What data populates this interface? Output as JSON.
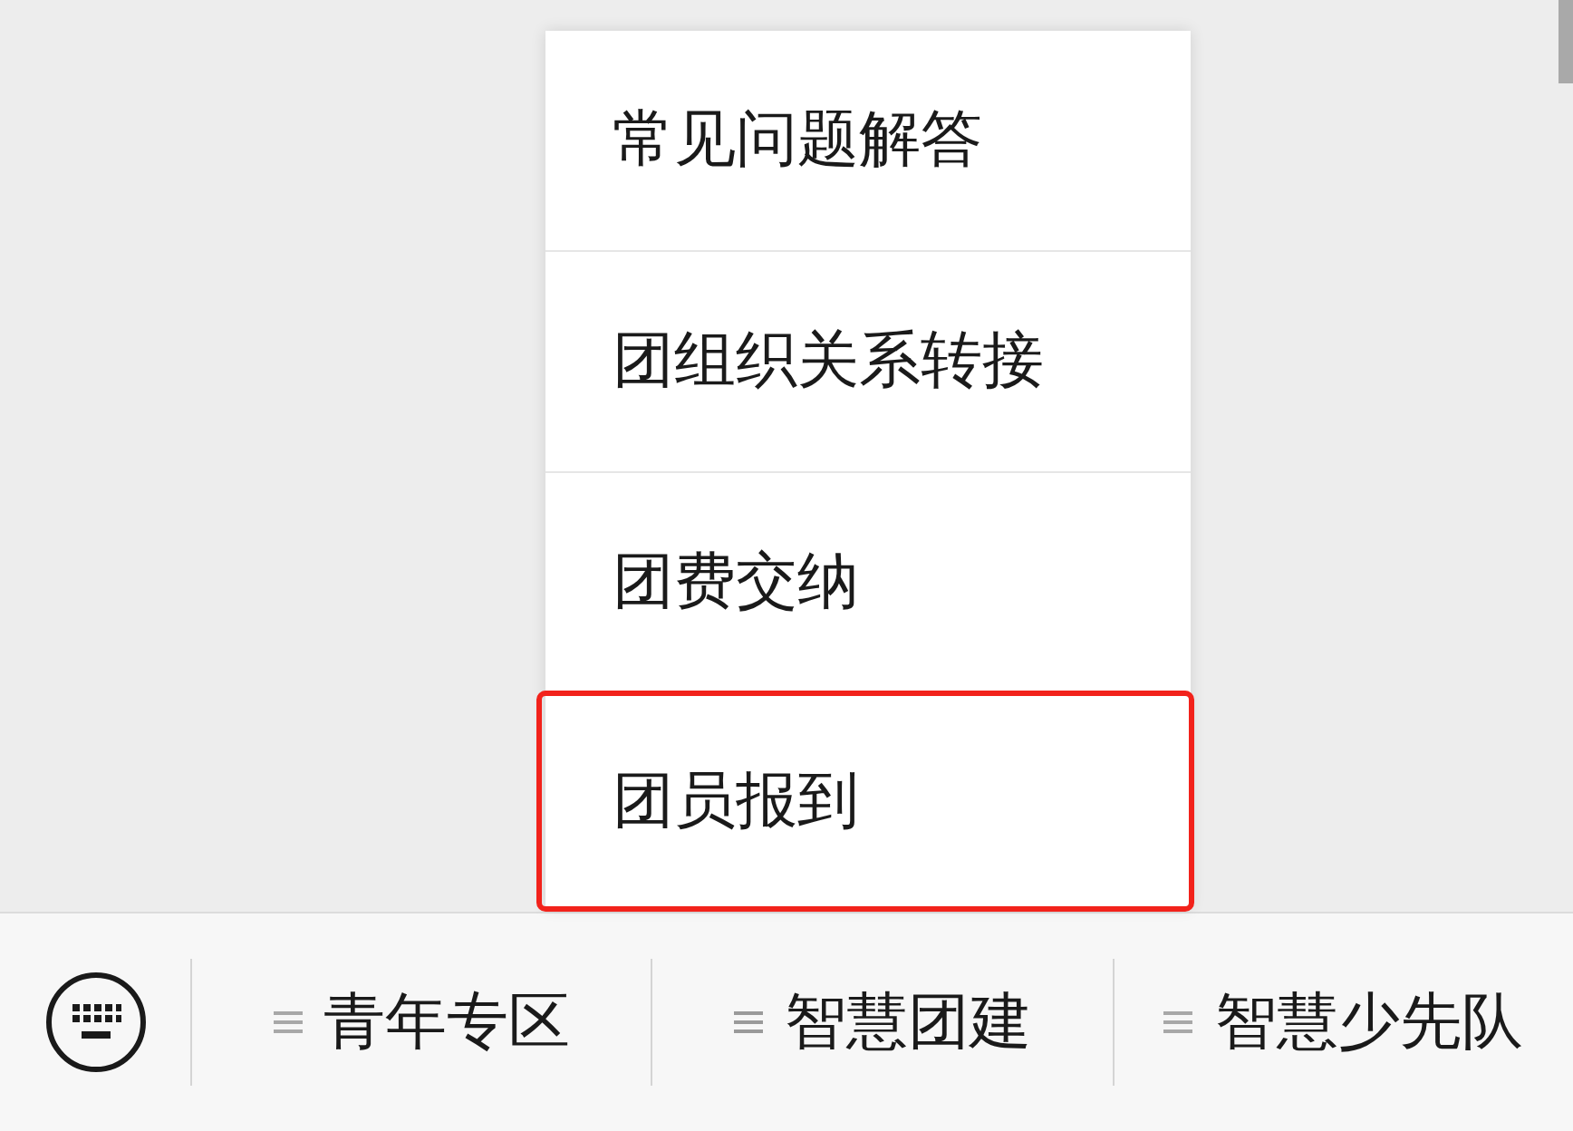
{
  "popup_menu": {
    "items": [
      {
        "label": "常见问题解答",
        "highlighted": false
      },
      {
        "label": "团组织关系转接",
        "highlighted": false
      },
      {
        "label": "团费交纳",
        "highlighted": false
      },
      {
        "label": "团员报到",
        "highlighted": true
      }
    ]
  },
  "bottom_menu": {
    "items": [
      {
        "label": "青年专区",
        "expanded": false
      },
      {
        "label": "智慧团建",
        "expanded": true
      },
      {
        "label": "智慧少先队",
        "expanded": false
      }
    ]
  }
}
